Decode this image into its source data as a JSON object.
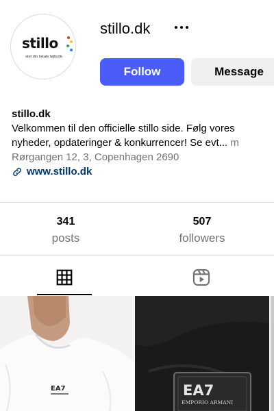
{
  "profile": {
    "username": "stillo.dk",
    "avatar": {
      "logo_text": "stillo",
      "tagline": "stet din lokale tøjbutik"
    }
  },
  "actions": {
    "follow_label": "Follow",
    "message_label": "Message"
  },
  "bio": {
    "name": "stillo.dk",
    "line1": "Velkommen til den officielle stillo side. Følg vores",
    "line2": "nyheder, opdateringer & konkurrencer! Se evt... ",
    "more": "m",
    "address": "Rørgangen 12, 3, Copenhagen 2690",
    "link": "www.stillo.dk"
  },
  "stats": [
    {
      "value": "341",
      "label": "posts"
    },
    {
      "value": "507",
      "label": "followers"
    }
  ],
  "tabs": [
    {
      "icon": "grid-icon",
      "active": true
    },
    {
      "icon": "reels-icon",
      "active": false
    }
  ],
  "posts": [
    {
      "brand_mark": "EA7"
    },
    {
      "brand_mark": "EA7",
      "brand_sub": "EMPORIO ARMANI"
    }
  ],
  "colors": {
    "primary": "#4a5df9",
    "link": "#00376b",
    "muted": "#737373",
    "divider": "#dbdbdb"
  }
}
